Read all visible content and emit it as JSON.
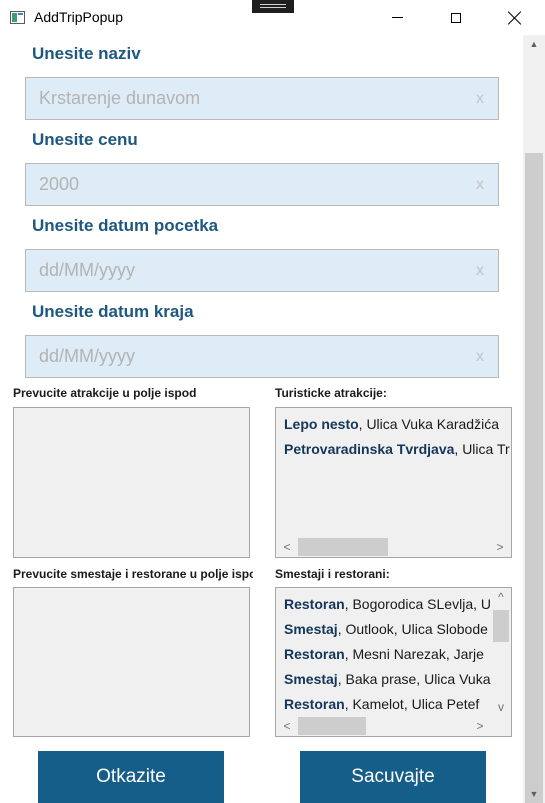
{
  "window": {
    "title": "AddTripPopup"
  },
  "form": {
    "name_label": "Unesite naziv",
    "name_placeholder": "Krstarenje dunavom",
    "price_label": "Unesite cenu",
    "price_placeholder": "2000",
    "start_label": "Unesite datum pocetka",
    "start_placeholder": "dd/MM/yyyy",
    "end_label": "Unesite datum kraja",
    "end_placeholder": "dd/MM/yyyy",
    "clear_glyph": "x"
  },
  "attractions": {
    "drop_label": "Prevucite atrakcije u polje ispod",
    "list_label": "Turisticke atrakcije:",
    "items": [
      {
        "name": "Lepo nesto",
        "rest": ", Ulica Vuka Karadžića"
      },
      {
        "name": "Petrovaradinska Tvrdjava",
        "rest": ", Ulica Tr"
      }
    ]
  },
  "accommodations": {
    "drop_label": "Prevucite smestaje i restorane u polje ispod",
    "list_label": "Smestaji i restorani:",
    "items": [
      {
        "name": "Restoran",
        "rest": ", Bogorodica SLevlja, U"
      },
      {
        "name": "Smestaj",
        "rest": ", Outlook, Ulica Slobode"
      },
      {
        "name": "Restoran",
        "rest": ", Mesni Narezak, Jarje"
      },
      {
        "name": "Smestaj",
        "rest": ", Baka prase, Ulica Vuka"
      },
      {
        "name": "Restoran",
        "rest": ", Kamelot, Ulica Petef"
      }
    ]
  },
  "buttons": {
    "cancel": "Otkazite",
    "save": "Sacuvajte"
  },
  "scroll_glyphs": {
    "up": "▲",
    "down": "▼",
    "left": "<",
    "right": ">",
    "small_up": "^",
    "small_down": "v"
  },
  "colors": {
    "accent": "#165e8a",
    "label": "#1e5780",
    "input_bg": "#deecf7"
  }
}
